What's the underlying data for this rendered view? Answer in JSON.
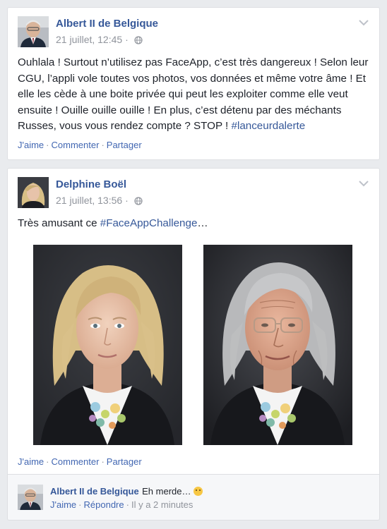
{
  "colors": {
    "link": "#365899",
    "meta": "#90949c",
    "background": "#e9ebee",
    "card": "#ffffff"
  },
  "post1": {
    "author": "Albert II de Belgique",
    "timestamp": "21 juillet, 12:45",
    "privacy_icon": "globe-icon",
    "text": "Ouhlala ! Surtout n’utilisez pas FaceApp, c’est très dangereux ! Selon leur CGU, l’appli vole toutes vos photos, vos données et même votre âme ! Et elle les cède à une boite privée qui peut les exploiter comme elle veut ensuite ! Ouille ouille ouille ! En plus, c’est détenu par des méchants Russes, vous vous rendez compte ? STOP ! ",
    "hashtag": "#lanceurdalerte",
    "actions": {
      "like": "J'aime",
      "comment": "Commenter",
      "share": "Partager"
    }
  },
  "post2": {
    "author": "Delphine Boël",
    "timestamp": "21 juillet, 13:56",
    "privacy_icon": "globe-icon",
    "text": "Très amusant ce ",
    "hashtag": "#FaceAppChallenge",
    "text_end": "…",
    "actions": {
      "like": "J'aime",
      "comment": "Commenter",
      "share": "Partager"
    }
  },
  "comment": {
    "author": "Albert II de Belgique",
    "text": "Eh merde…",
    "emoji": "worried-face-emoji",
    "like": "J'aime",
    "reply": "Répondre",
    "time": "Il y a 2 minutes"
  }
}
